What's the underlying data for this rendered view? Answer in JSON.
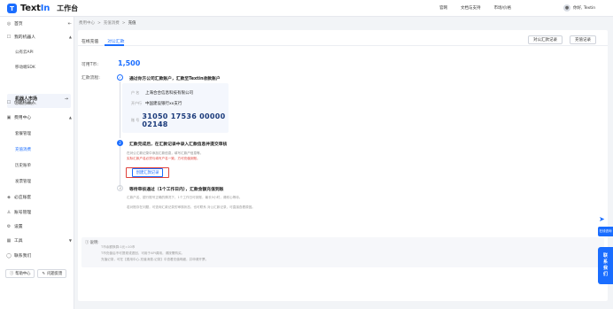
{
  "topbar": {
    "logo_mark": "T",
    "logo_text": "Text",
    "logo_text_in": "In",
    "workspace": "工作台",
    "nav": [
      "官网",
      "文档与支持",
      "市场/价格"
    ],
    "user": "你好, Textin"
  },
  "sidebar": {
    "home": "首页",
    "robots": "我的机器人",
    "robot_items": [
      "公有云API",
      "移动端SDK"
    ],
    "robot_market": "机器人市场",
    "robot_market_sub": "发现更多机器人",
    "create_robot": "创建机器人",
    "fees": "费用中心",
    "fee_items": [
      "套餐管理",
      "充值消费",
      "历史账单",
      "发票管理"
    ],
    "bill": "必应账套",
    "accounts": "账号管理",
    "settings": "设置",
    "tools": "工具",
    "contact": "联系我们",
    "help_btn": "帮助中心",
    "feedback_btn": "问题反馈"
  },
  "breadcrumb": {
    "items": [
      "费用中心",
      "充值消费"
    ],
    "current": "充值"
  },
  "tabs": {
    "online": "在线充值",
    "transfer": "对公汇款"
  },
  "buttons": {
    "transfer_records": "对公汇款记录",
    "recharge_records": "充值记录"
  },
  "balance": {
    "label": "可用T币:",
    "value": "1,500"
  },
  "flow_label": "汇款流程:",
  "steps": {
    "s1": "通过你方公司汇款账户，汇款至Textin收款账户",
    "s2": "汇款完成后，在汇款记录中录入汇款信息并提交审核",
    "s3": "等待审核通过（1个工作日内），汇款金额充值到账"
  },
  "account": {
    "name_key": "户 名",
    "name_val": "上海合合信息科技有限公司",
    "bank_key": "开户行",
    "bank_val": "中国建设银行xx支行",
    "no_key": "账 号",
    "no_val": "31050 17536 00000 02148"
  },
  "step2_notes": {
    "n1": "在对公汇款记录中添加汇款信息，填写汇款户信息等。",
    "n2": "实际汇款户名必须与填写户名一致，方可充值到账。"
  },
  "create_record_btn": "创建汇款记录",
  "step3_notes": {
    "n1": "汇款户名、银行账号正确的情况下，1个工作日可到账，最长5小时，请耐心等待。",
    "n2": "若对账存在问题，可查询汇款记录的审核状态，也可联系 对公汇款记录，可直接查看原因。"
  },
  "help": {
    "title": "说明:",
    "lines": [
      "T币余额换算:1元=10币",
      "T币充值后不可提现或退回，可用于API调用，请按需购买。",
      "充值记录，可在【费用中心-充值消费-记录】中查看充值明细，并申请开票。"
    ]
  },
  "float": {
    "chat": "在线咨询",
    "contact": [
      "联",
      "系",
      "我",
      "们"
    ]
  }
}
